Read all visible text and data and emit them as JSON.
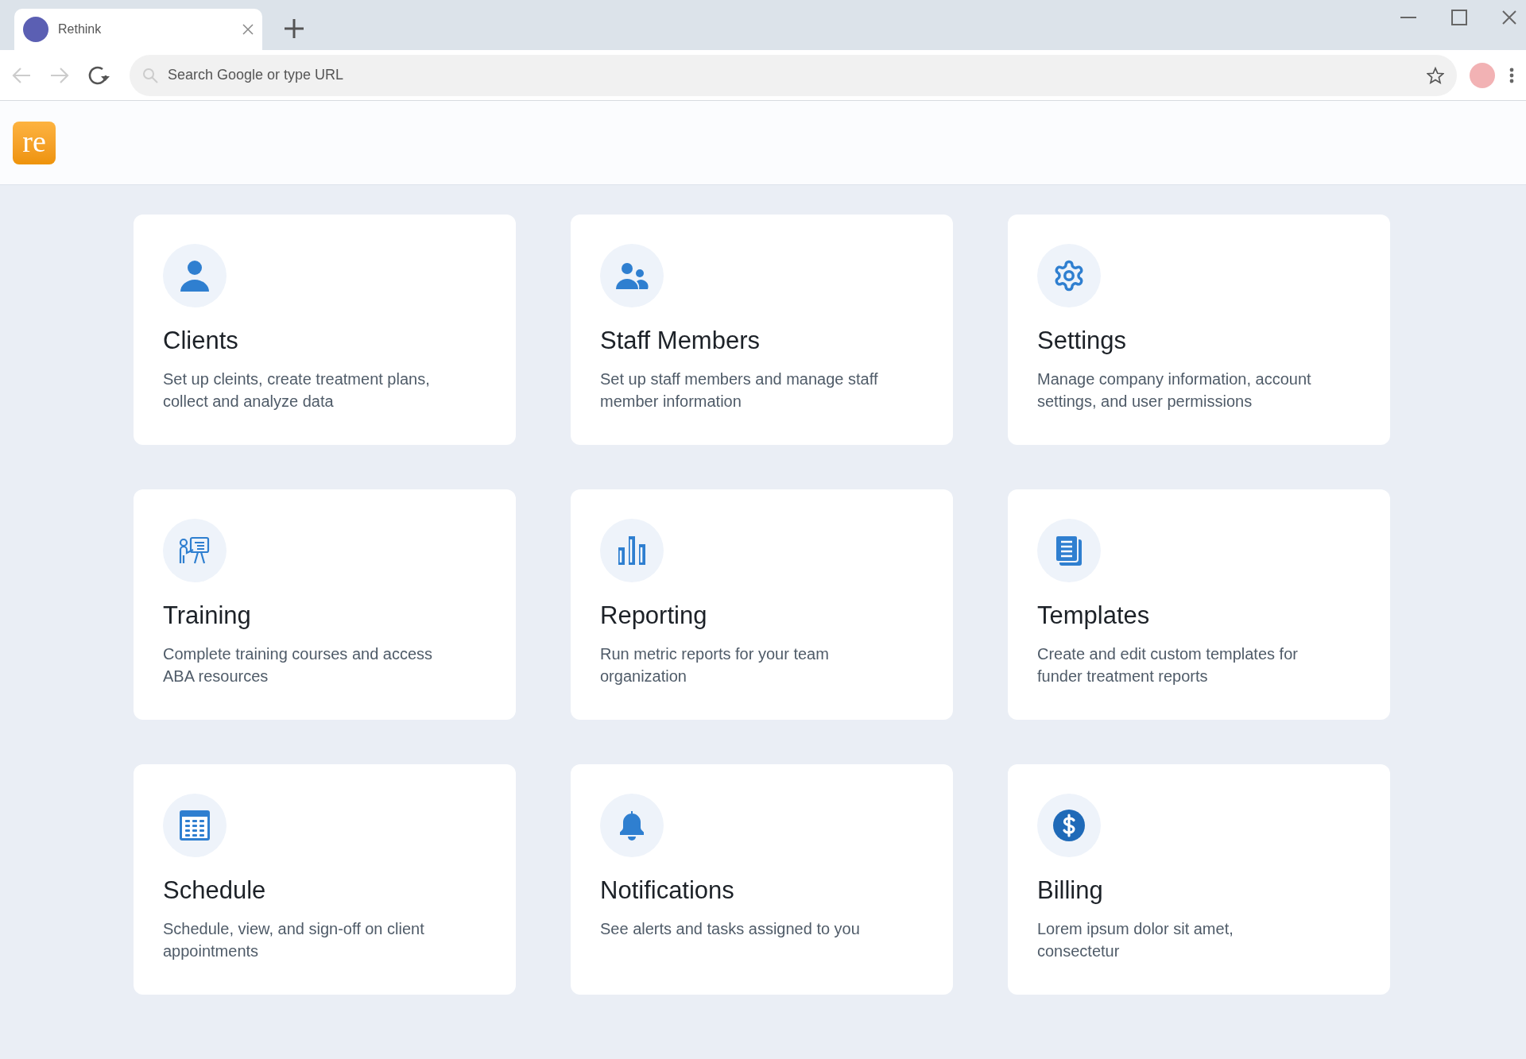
{
  "browser": {
    "tab": {
      "title": "Rethink",
      "selected": true
    },
    "address_bar": {
      "placeholder": "Search Google or type URL"
    }
  },
  "app": {
    "logo": "re"
  },
  "cards": [
    {
      "title": "Clients",
      "description": "Set up cleints, create treatment plans, collect and analyze data"
    },
    {
      "title": "Staff Members",
      "description": "Set up staff members and manage staff member information"
    },
    {
      "title": "Settings",
      "description": "Manage company information, account settings, and user permissions"
    },
    {
      "title": "Training",
      "description": "Complete training courses and access ABA resources"
    },
    {
      "title": "Reporting",
      "description": "Run metric reports for your team organization"
    },
    {
      "title": "Templates",
      "description": "Create and edit custom templates for funder treatment reports"
    },
    {
      "title": "Schedule",
      "description": "Schedule, view, and sign-off on client appointments"
    },
    {
      "title": "Notifications",
      "description": "See alerts and tasks assigned to you"
    },
    {
      "title": "Billing",
      "description": "Lorem ipsum dolor sit amet, consectetur"
    }
  ]
}
